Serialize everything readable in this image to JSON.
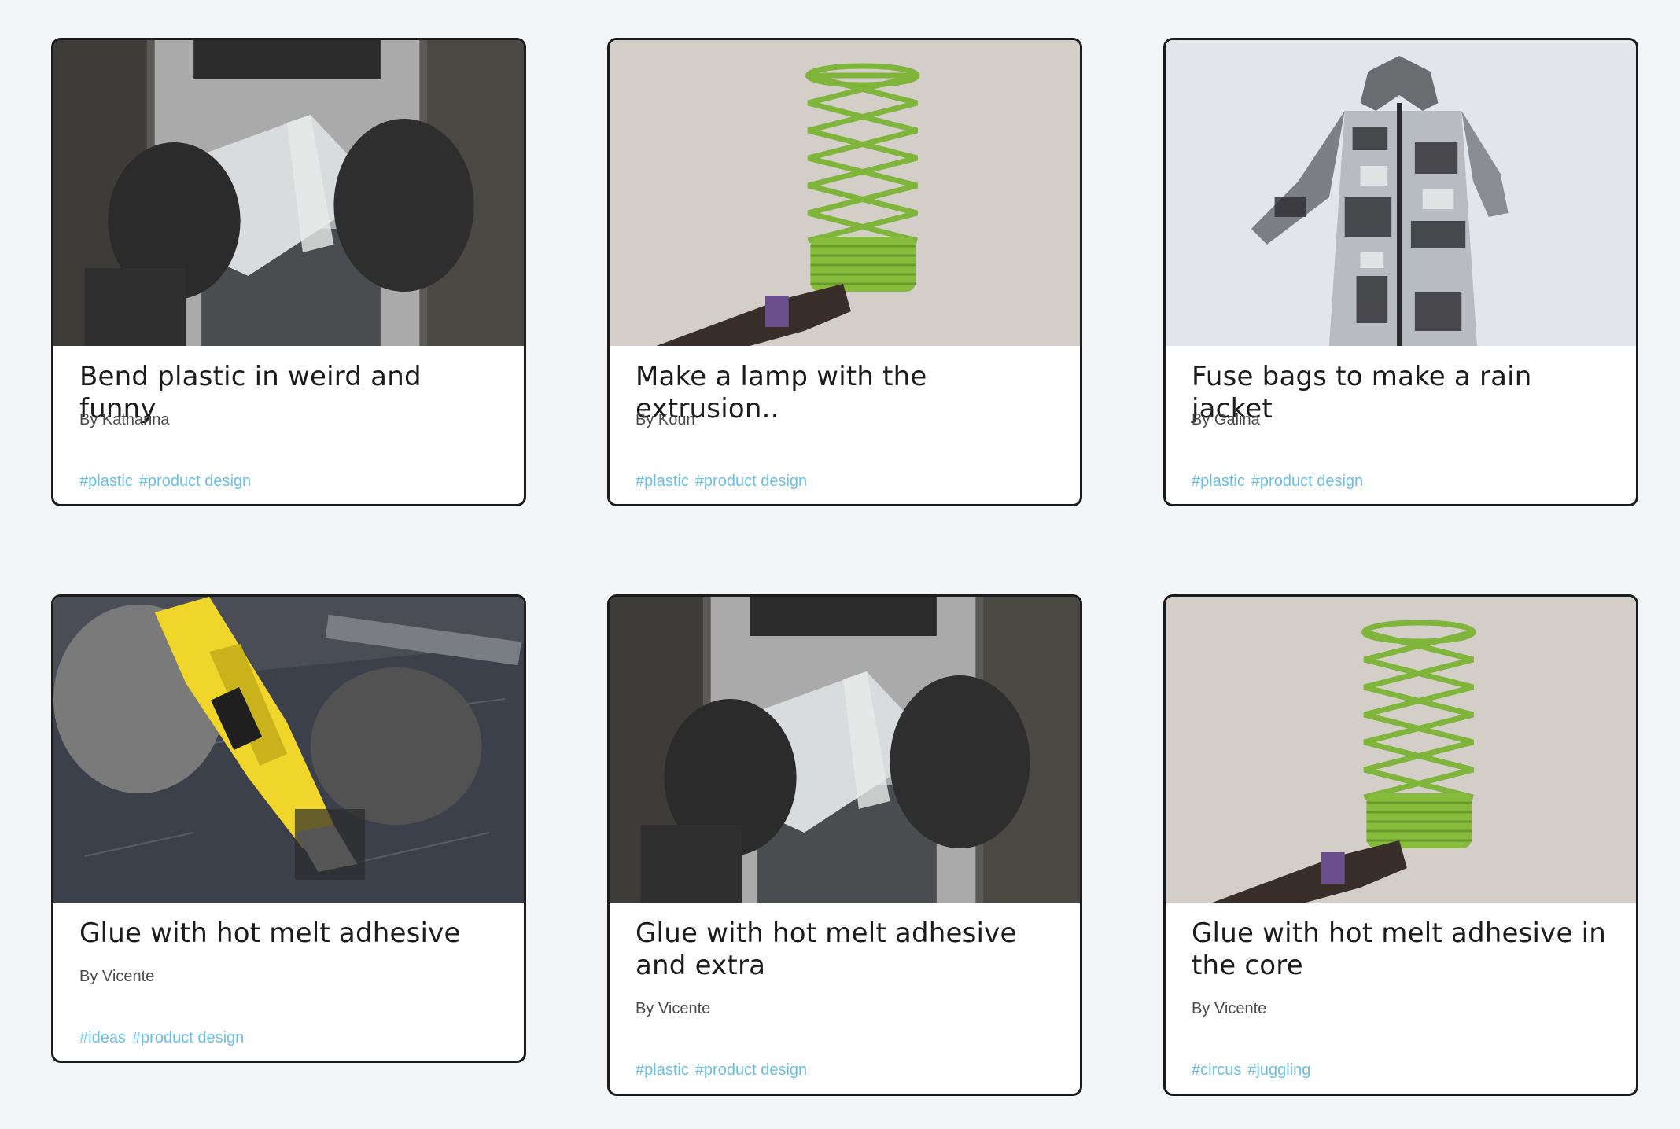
{
  "cards": [
    {
      "title": "Bend plastic in weird and funny",
      "author": "By Katharina",
      "tags": [
        "#plastic",
        "#product design"
      ],
      "image": "gloved-hands-bending-plastic-sheet"
    },
    {
      "title": "Make a lamp with the extrusion..",
      "author": "By Koun",
      "tags": [
        "#plastic",
        "#product design"
      ],
      "image": "green-spiral-lamp-in-hand"
    },
    {
      "title": "Fuse bags to make a rain jacket",
      "author": "By Galina",
      "tags": [
        "#plastic",
        "#product design"
      ],
      "image": "fused-plastic-rain-jacket"
    },
    {
      "title": "Glue with hot melt adhesive",
      "author": "By Vicente",
      "tags": [
        "#ideas",
        "#product design"
      ],
      "image": "yellow-hot-glue-gun"
    },
    {
      "title": "Glue with hot melt adhesive and extra",
      "author": "By Vicente",
      "tags": [
        "#plastic",
        "#product design"
      ],
      "image": "gloved-hands-bending-plastic-sheet"
    },
    {
      "title": "Glue with hot melt adhesive in the core",
      "author": "By Vicente",
      "tags": [
        "#circus",
        "#juggling"
      ],
      "image": "green-spiral-lamp-in-hand"
    }
  ],
  "colors": {
    "background": "#f4f5f7",
    "card_border": "#1b1b1b",
    "tag": "#6bbfe3",
    "author": "#4a4a4a"
  }
}
